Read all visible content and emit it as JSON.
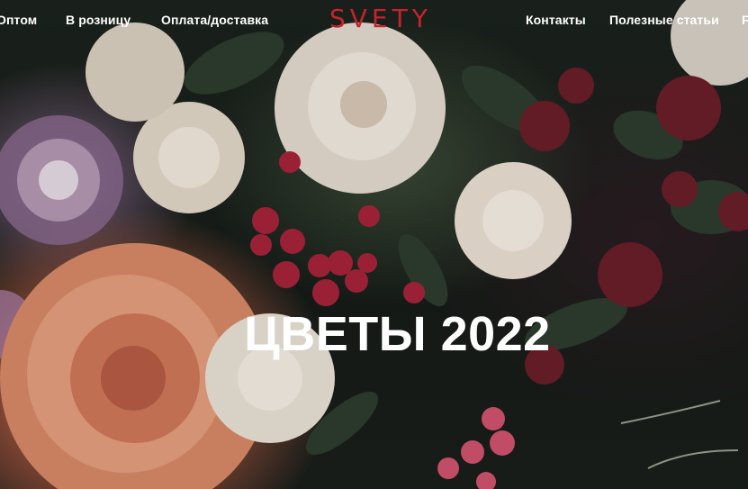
{
  "header": {
    "logo": "SVETY",
    "nav_left": [
      "Оптом",
      "В розницу",
      "Оплата/доставка"
    ],
    "nav_right": [
      "Контакты",
      "Полезные статьи",
      "F"
    ]
  },
  "hero": {
    "title": "ЦВЕТЫ 2022"
  },
  "colors": {
    "logo": "#c4242b",
    "nav_text": "#ffffff",
    "title_text": "#ffffff"
  }
}
